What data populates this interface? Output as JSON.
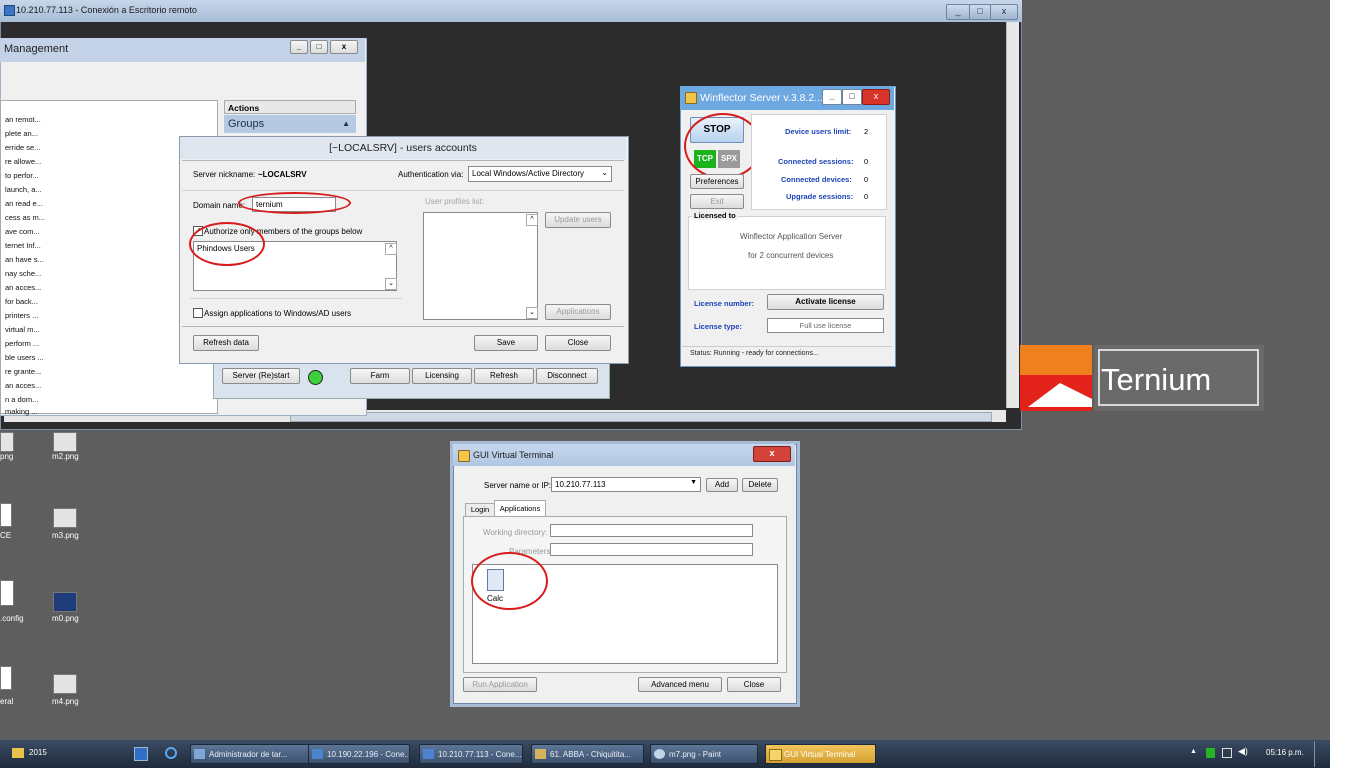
{
  "rdp": {
    "title": "10.210.77.113 - Conexión a Escritorio remoto",
    "min": "_",
    "max": "□",
    "close": "x"
  },
  "mgmt": {
    "title": "Management",
    "rows": [
      "an remot...",
      "plete an...",
      "erride se...",
      "re allowe...",
      "to perfor...",
      "launch, a...",
      "an read e...",
      "cess as m...",
      "ave com...",
      "ternet Inf...",
      "an have s...",
      "nay sche...",
      "an acces...",
      "for back...",
      "printers ...",
      "virtual m...",
      "perform ...",
      "ble users ...",
      "re grante...",
      "an acces...",
      "n a dom...",
      "making ..."
    ],
    "actions": "Actions",
    "groups": "Groups",
    "buttons": {
      "server_restart": "Server (Re)start",
      "farm": "Farm",
      "licensing": "Licensing",
      "refresh": "Refresh",
      "disconnect": "Disconnect"
    }
  },
  "ua": {
    "title": "[~LOCALSRV] - users accounts",
    "nickname_label": "Server nickname:",
    "nickname_value": "~LOCALSRV",
    "auth_label": "Authentication via:",
    "auth_value": "Local Windows/Active Directory",
    "domain_label": "Domain name:",
    "domain_value": "ternium",
    "profiles_label": "User profiles list:",
    "update_users": "Update users",
    "authorize_label": "Authorize only members of the groups below",
    "groups": [
      "Phindows Users"
    ],
    "assign_label": "Assign applications to Windows/AD users",
    "applications": "Applications",
    "refresh_data": "Refresh data",
    "save": "Save",
    "close": "Close"
  },
  "wf": {
    "title": "Winflector Server v.3.8.2....",
    "stop": "STOP",
    "tcp": "TCP",
    "spx": "SPX",
    "preferences": "Preferences",
    "exit": "Exit",
    "device_limit_label": "Device users limit:",
    "device_limit_value": "2",
    "conn_sessions_label": "Connected sessions:",
    "conn_sessions_value": "0",
    "conn_devices_label": "Connected devices:",
    "conn_devices_value": "0",
    "upgrade_label": "Upgrade sessions:",
    "upgrade_value": "0",
    "licensed_to": "Licensed to",
    "lic_line1": "Winflector Application Server",
    "lic_line2": "for 2 concurrent devices",
    "license_number_label": "License number:",
    "activate": "Activate license",
    "license_type_label": "License type:",
    "license_type_value": "Full use license",
    "status": "Status:   Running - ready for connections..."
  },
  "logo": {
    "text": "Ternium"
  },
  "desktop": {
    "icons": [
      {
        "label": "png"
      },
      {
        "label": "m2.png"
      },
      {
        "label": "CE"
      },
      {
        "label": "m3.png"
      },
      {
        "label": ".config"
      },
      {
        "label": "m0.png"
      },
      {
        "label": "eral"
      },
      {
        "label": "m4.png"
      }
    ]
  },
  "gvt": {
    "title": "GUI Virtual Terminal",
    "close": "x",
    "server_label": "Server name or IP:",
    "server_value": "10.210.77.113",
    "add": "Add",
    "delete": "Delete",
    "tabs": [
      "Login",
      "Applications"
    ],
    "workdir_label": "Working directory:",
    "params_label": "Parameters:",
    "app_name": "Calc",
    "run": "Run Application",
    "advanced": "Advanced menu",
    "close_btn": "Close"
  },
  "taskbar": {
    "start": "2015",
    "tasks": [
      "Administrador de tar...",
      "10.190.22.196 - Cone...",
      "10.210.77.113 - Cone...",
      "61. ABBA - Chiquitita...",
      "m7.png - Paint",
      "GUI Virtual Terminal"
    ],
    "clock": "05:16 p.m."
  }
}
